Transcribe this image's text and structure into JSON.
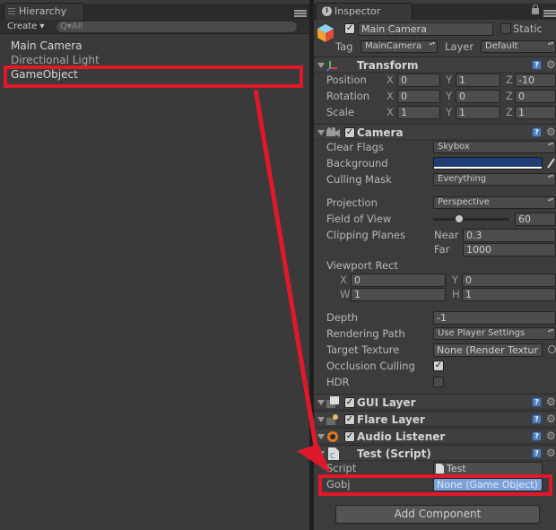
{
  "hierarchy": {
    "tab_label": "Hierarchy",
    "create_label": "Create ▾",
    "search_placeholder": "Q▾All",
    "items": [
      "Main Camera",
      "Directional Light",
      "GameObject"
    ]
  },
  "inspector": {
    "tab_label": "Inspector",
    "object": {
      "active": true,
      "name": "Main Camera",
      "static_label": "Static",
      "tag_label": "Tag",
      "tag_value": "MainCamera",
      "layer_label": "Layer",
      "layer_value": "Default"
    },
    "transform": {
      "title": "Transform",
      "rows": [
        {
          "label": "Position",
          "x": "0",
          "y": "1",
          "z": "-10"
        },
        {
          "label": "Rotation",
          "x": "0",
          "y": "0",
          "z": "0"
        },
        {
          "label": "Scale",
          "x": "1",
          "y": "1",
          "z": "1"
        }
      ],
      "axis_x": "X",
      "axis_y": "Y",
      "axis_z": "Z"
    },
    "camera": {
      "title": "Camera",
      "clear_flags_label": "Clear Flags",
      "clear_flags_value": "Skybox",
      "background_label": "Background",
      "background_color": "#1f3e73",
      "culling_mask_label": "Culling Mask",
      "culling_mask_value": "Everything",
      "projection_label": "Projection",
      "projection_value": "Perspective",
      "fov_label": "Field of View",
      "fov_value": "60",
      "clipping_label": "Clipping Planes",
      "near_label": "Near",
      "near_value": "0.3",
      "far_label": "Far",
      "far_value": "1000",
      "viewport_label": "Viewport Rect",
      "vp_x_label": "X",
      "vp_x": "0",
      "vp_y_label": "Y",
      "vp_y": "0",
      "vp_w_label": "W",
      "vp_w": "1",
      "vp_h_label": "H",
      "vp_h": "1",
      "depth_label": "Depth",
      "depth_value": "-1",
      "rendering_path_label": "Rendering Path",
      "rendering_path_value": "Use Player Settings",
      "target_texture_label": "Target Texture",
      "target_texture_value": "None (Render Textur",
      "occlusion_label": "Occlusion Culling",
      "occlusion_checked": true,
      "hdr_label": "HDR",
      "hdr_checked": false
    },
    "gui_layer_title": "GUI Layer",
    "flare_layer_title": "Flare Layer",
    "audio_listener_title": "Audio Listener",
    "test_script": {
      "title": "Test (Script)",
      "script_label": "Script",
      "script_value": "Test",
      "gobj_label": "Gobj",
      "gobj_value": "None (Game Object)"
    },
    "add_component_label": "Add Component"
  },
  "colors": {
    "annotation": "#e0192a",
    "selection": "#7ca0d8"
  }
}
